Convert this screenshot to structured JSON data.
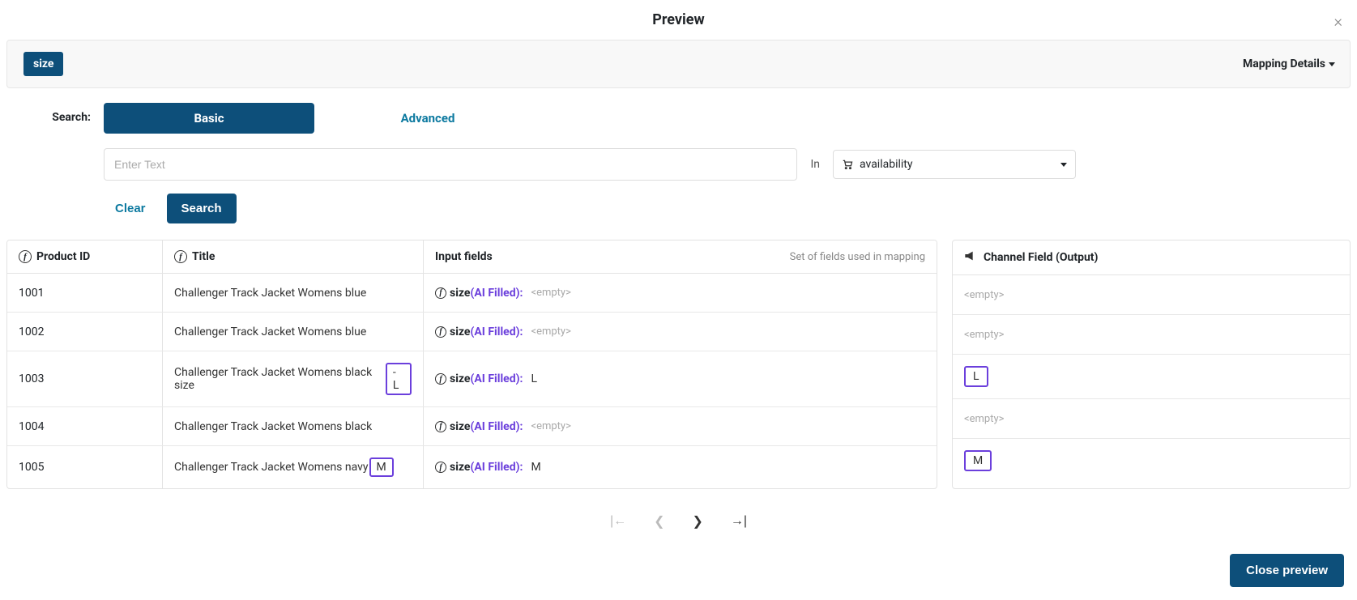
{
  "title": "Preview",
  "chip": "size",
  "mapping_details": "Mapping Details",
  "search": {
    "label": "Search:",
    "tab_basic": "Basic",
    "tab_advanced": "Advanced",
    "placeholder": "Enter Text",
    "in_label": "In",
    "dropdown_value": "availability",
    "clear": "Clear",
    "search_btn": "Search"
  },
  "headers": {
    "product_id": "Product ID",
    "title": "Title",
    "input_fields": "Input fields",
    "input_sub": "Set of fields used in mapping",
    "channel_output": "Channel Field (Output)"
  },
  "input_field_label": "size",
  "ai_filled": "(AI Filled)",
  "empty": "<empty>",
  "rows": [
    {
      "id": "1001",
      "title_pre": "Challenger Track Jacket Womens blue",
      "title_hl": "",
      "value": "",
      "output": ""
    },
    {
      "id": "1002",
      "title_pre": "Challenger Track Jacket Womens blue",
      "title_hl": "",
      "value": "",
      "output": ""
    },
    {
      "id": "1003",
      "title_pre": "Challenger Track Jacket Womens black size",
      "title_hl": "- L",
      "value": "L",
      "output": "L"
    },
    {
      "id": "1004",
      "title_pre": "Challenger Track Jacket Womens black",
      "title_hl": "",
      "value": "",
      "output": ""
    },
    {
      "id": "1005",
      "title_pre": "Challenger Track Jacket Womens navy",
      "title_hl": " M",
      "value": "M",
      "output": "M"
    }
  ],
  "close_preview": "Close preview"
}
